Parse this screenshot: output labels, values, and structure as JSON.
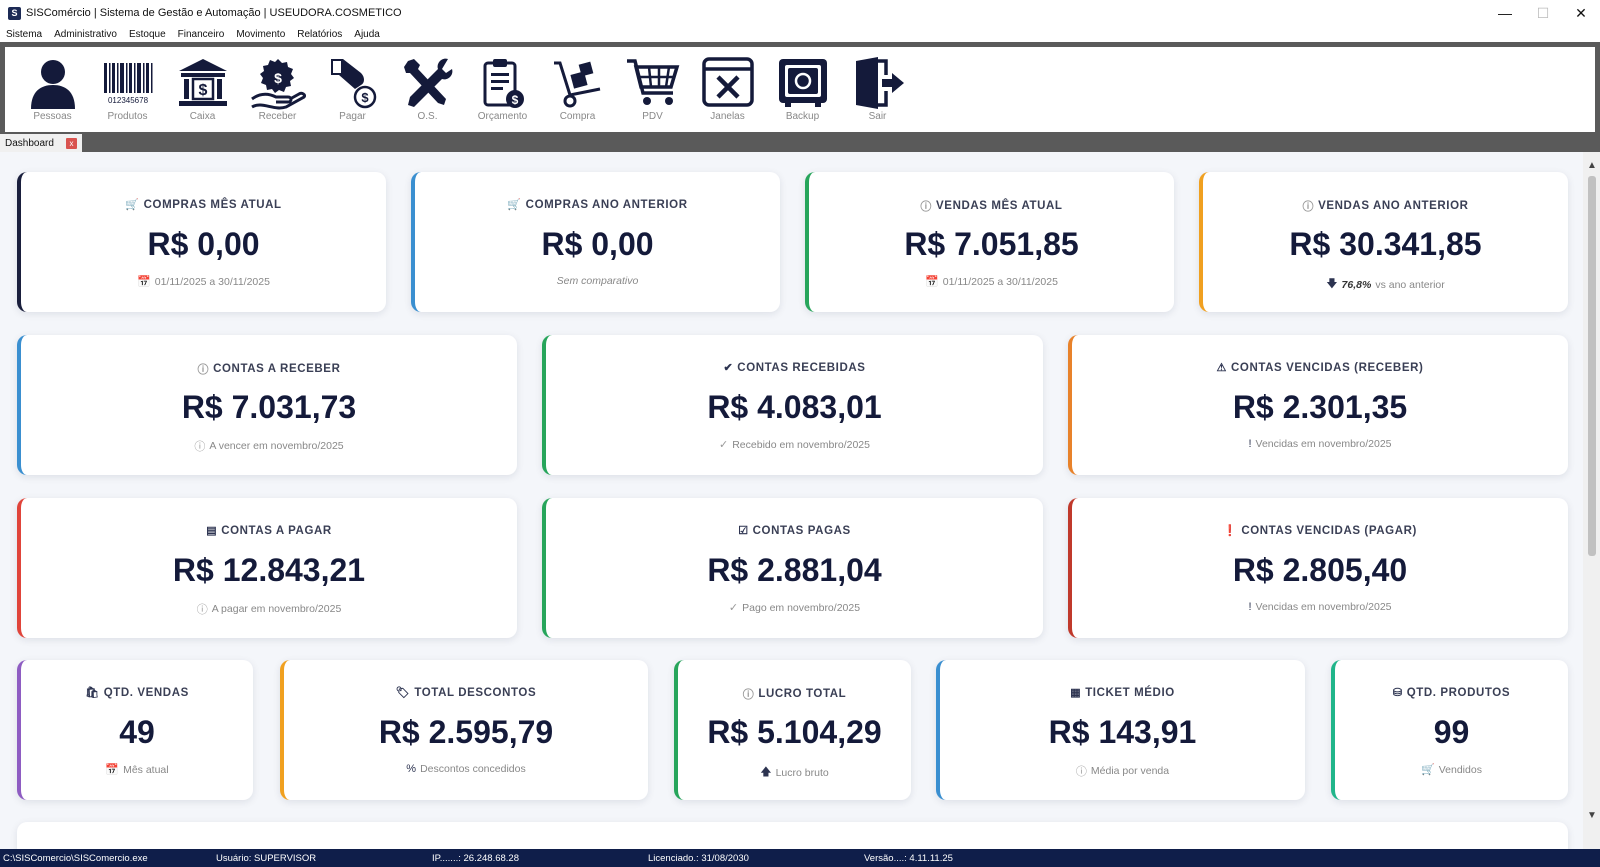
{
  "window": {
    "title": "SISComércio | Sistema de Gestão e Automação | USEUDORA.COSMETICO",
    "app_icon": "S"
  },
  "menu": [
    "Sistema",
    "Administrativo",
    "Estoque",
    "Financeiro",
    "Movimento",
    "Relatórios",
    "Ajuda"
  ],
  "toolbar": [
    {
      "label": "Pessoas",
      "icon": "person-icon"
    },
    {
      "label": "Produtos",
      "icon": "barcode-icon",
      "barcode_text": "012345678"
    },
    {
      "label": "Caixa",
      "icon": "bank-icon",
      "bank_text": "$"
    },
    {
      "label": "Receber",
      "icon": "receive-money-icon"
    },
    {
      "label": "Pagar",
      "icon": "pay-money-icon"
    },
    {
      "label": "O.S.",
      "icon": "tools-icon"
    },
    {
      "label": "Orçamento",
      "icon": "clipboard-money-icon"
    },
    {
      "label": "Compra",
      "icon": "hand-truck-icon"
    },
    {
      "label": "PDV",
      "icon": "shopping-cart-icon"
    },
    {
      "label": "Janelas",
      "icon": "close-window-icon"
    },
    {
      "label": "Backup",
      "icon": "safe-icon"
    },
    {
      "label": "Sair",
      "icon": "exit-door-icon"
    }
  ],
  "tabs": [
    {
      "label": "Dashboard",
      "close": "x"
    }
  ],
  "cards": {
    "compras_mes": {
      "title": "COMPRAS MÊS ATUAL",
      "value": "R$ 0,00",
      "sub": "01/11/2025 a 30/11/2025",
      "icon": "cart-icon",
      "sub_icon": "calendar-icon",
      "accent": "#1a1f3d"
    },
    "compras_ano": {
      "title": "COMPRAS ANO ANTERIOR",
      "value": "R$ 0,00",
      "sub": "Sem comparativo",
      "icon": "cart-icon",
      "accent": "#3a8fd0"
    },
    "vendas_mes": {
      "title": "VENDAS MÊS ATUAL",
      "value": "R$ 7.051,85",
      "sub": "01/11/2025 a 30/11/2025",
      "icon": "question-icon",
      "sub_icon": "calendar-icon",
      "accent": "#27a55b"
    },
    "vendas_ano": {
      "title": "VENDAS ANO ANTERIOR",
      "value": "R$ 30.341,85",
      "sub_pct": "76,8%",
      "sub": "vs ano anterior",
      "icon": "question-icon",
      "sub_icon": "arrow-down-icon",
      "accent": "#f0a020"
    },
    "contas_receber": {
      "title": "CONTAS A RECEBER",
      "value": "R$ 7.031,73",
      "sub": "A vencer em novembro/2025",
      "icon": "question-icon",
      "sub_icon": "question-icon",
      "accent": "#3a8fd0"
    },
    "contas_recebidas": {
      "title": "CONTAS RECEBIDAS",
      "value": "R$ 4.083,01",
      "sub": "Recebido em novembro/2025",
      "icon": "check-circle-icon",
      "sub_icon": "check-icon",
      "accent": "#27a55b"
    },
    "vencidas_receber": {
      "title": "CONTAS VENCIDAS (RECEBER)",
      "value": "R$ 2.301,35",
      "sub": "Vencidas em novembro/2025",
      "icon": "warning-icon",
      "sub_icon": "exclamation-icon",
      "accent": "#e8822a"
    },
    "contas_pagar": {
      "title": "CONTAS A PAGAR",
      "value": "R$ 12.843,21",
      "sub": "A pagar em novembro/2025",
      "icon": "credit-card-icon",
      "sub_icon": "question-icon",
      "accent": "#e0443a"
    },
    "contas_pagas": {
      "title": "CONTAS PAGAS",
      "value": "R$ 2.881,04",
      "sub": "Pago em novembro/2025",
      "icon": "checkbox-icon",
      "sub_icon": "check-icon",
      "accent": "#27a55b"
    },
    "vencidas_pagar": {
      "title": "CONTAS VENCIDAS (PAGAR)",
      "value": "R$ 2.805,40",
      "sub": "Vencidas em novembro/2025",
      "icon": "exclamation-circle-icon",
      "sub_icon": "exclamation-icon",
      "accent": "#c0392b"
    },
    "qtd_vendas": {
      "title": "QTD. VENDAS",
      "value": "49",
      "sub": "Mês atual",
      "icon": "bag-icon",
      "sub_icon": "calendar-icon",
      "accent": "#8e5cc2"
    },
    "total_descontos": {
      "title": "TOTAL DESCONTOS",
      "value": "R$ 2.595,79",
      "sub": "Descontos concedidos",
      "icon": "tag-icon",
      "sub_icon": "percent-icon",
      "accent": "#f0a020"
    },
    "lucro_total": {
      "title": "LUCRO TOTAL",
      "value": "R$ 5.104,29",
      "sub": "Lucro bruto",
      "icon": "question-icon",
      "sub_icon": "arrow-up-icon",
      "accent": "#27a55b"
    },
    "ticket_medio": {
      "title": "TICKET MÉDIO",
      "value": "R$ 143,91",
      "sub": "Média por venda",
      "icon": "calculator-icon",
      "sub_icon": "question-icon",
      "accent": "#3a8fd0"
    },
    "qtd_produtos": {
      "title": "QTD. PRODUTOS",
      "value": "99",
      "sub": "Vendidos",
      "icon": "boxes-icon",
      "sub_icon": "cart-icon",
      "accent": "#20b58a"
    }
  },
  "status": {
    "path": "C:\\SISComercio\\SISComercio.exe",
    "user": "Usuário: SUPERVISOR",
    "ip": "IP.......: 26.248.68.28",
    "license": "Licenciado.: 31/08/2030",
    "version": "Versão....: 4.11.11.25"
  }
}
